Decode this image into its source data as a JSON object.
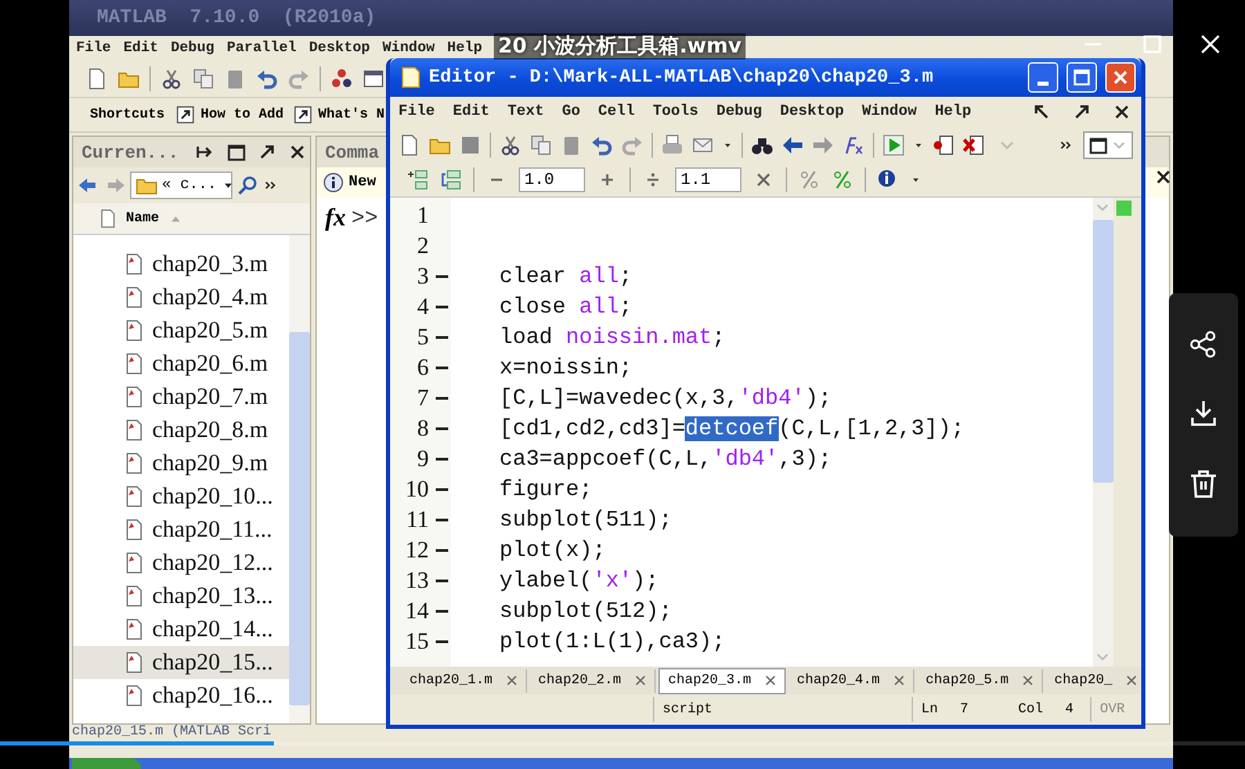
{
  "player": {
    "title": "20 小波分析工具箱.wmv",
    "progress": {
      "level": 0.22
    }
  },
  "matlab": {
    "title": "MATLAB  7.10.0  (R2010a)",
    "menu": [
      "File",
      "Edit",
      "Debug",
      "Parallel",
      "Desktop",
      "Window",
      "Help"
    ],
    "shortcuts": [
      {
        "kind": "label",
        "text": "Shortcuts"
      },
      {
        "kind": "link",
        "text": "How to Add"
      },
      {
        "kind": "link",
        "text": "What's N"
      }
    ],
    "current_folder": {
      "title": "Curren...",
      "path": "« c...",
      "column": "Name",
      "files": [
        {
          "name": "chap20_3.m",
          "selected": false
        },
        {
          "name": "chap20_4.m",
          "selected": false
        },
        {
          "name": "chap20_5.m",
          "selected": false
        },
        {
          "name": "chap20_6.m",
          "selected": false
        },
        {
          "name": "chap20_7.m",
          "selected": false
        },
        {
          "name": "chap20_8.m",
          "selected": false
        },
        {
          "name": "chap20_9.m",
          "selected": false
        },
        {
          "name": "chap20_10...",
          "selected": false
        },
        {
          "name": "chap20_11...",
          "selected": false
        },
        {
          "name": "chap20_12...",
          "selected": false
        },
        {
          "name": "chap20_13...",
          "selected": false
        },
        {
          "name": "chap20_14...",
          "selected": false
        },
        {
          "name": "chap20_15...",
          "selected": true
        },
        {
          "name": "chap20_16...",
          "selected": false
        }
      ]
    },
    "command_window": {
      "title": "Comma",
      "notice": "New",
      "fx": "fx",
      "prompt": ">>"
    },
    "status": "chap20_15.m (MATLAB Scri"
  },
  "editor": {
    "title": "Editor - D:\\Mark-ALL-MATLAB\\chap20\\chap20_3.m",
    "menu": [
      "File",
      "Edit",
      "Text",
      "Go",
      "Cell",
      "Tools",
      "Debug",
      "Desktop",
      "Window",
      "Help"
    ],
    "zoom_value": "1.0",
    "factor_value": "1.1",
    "lines": [
      {
        "number": "1",
        "executable": false
      },
      {
        "number": "2",
        "executable": false
      },
      {
        "number": "3",
        "executable": true,
        "segments": [
          {
            "kind": "plain",
            "text": "clear "
          },
          {
            "kind": "string",
            "text": "all"
          },
          {
            "kind": "plain",
            "text": ";"
          }
        ]
      },
      {
        "number": "4",
        "executable": true,
        "segments": [
          {
            "kind": "plain",
            "text": "close "
          },
          {
            "kind": "string",
            "text": "all"
          },
          {
            "kind": "plain",
            "text": ";"
          }
        ]
      },
      {
        "number": "5",
        "executable": true,
        "segments": [
          {
            "kind": "plain",
            "text": "load "
          },
          {
            "kind": "string",
            "text": "noissin.mat"
          },
          {
            "kind": "plain",
            "text": ";"
          }
        ]
      },
      {
        "number": "6",
        "executable": true,
        "segments": [
          {
            "kind": "plain",
            "text": "x=noissin;"
          }
        ]
      },
      {
        "number": "7",
        "executable": true,
        "segments": [
          {
            "kind": "plain",
            "text": "[C,L]=wavedec(x,3,"
          },
          {
            "kind": "string",
            "text": "'db4'"
          },
          {
            "kind": "plain",
            "text": ");"
          }
        ]
      },
      {
        "number": "8",
        "executable": true,
        "segments": [
          {
            "kind": "plain",
            "text": "[cd1,cd2,cd3]="
          },
          {
            "kind": "selected",
            "text": "detcoef"
          },
          {
            "kind": "plain",
            "text": "(C,L,[1,2,3]);"
          }
        ]
      },
      {
        "number": "9",
        "executable": true,
        "segments": [
          {
            "kind": "plain",
            "text": "ca3=appcoef(C,L,"
          },
          {
            "kind": "string",
            "text": "'db4'"
          },
          {
            "kind": "plain",
            "text": ",3);"
          }
        ]
      },
      {
        "number": "10",
        "executable": true,
        "segments": [
          {
            "kind": "plain",
            "text": "figure;"
          }
        ]
      },
      {
        "number": "11",
        "executable": true,
        "segments": [
          {
            "kind": "plain",
            "text": "subplot(511);"
          }
        ]
      },
      {
        "number": "12",
        "executable": true,
        "segments": [
          {
            "kind": "plain",
            "text": "plot(x);"
          }
        ]
      },
      {
        "number": "13",
        "executable": true,
        "segments": [
          {
            "kind": "plain",
            "text": "ylabel("
          },
          {
            "kind": "string",
            "text": "'x'"
          },
          {
            "kind": "plain",
            "text": ");"
          }
        ]
      },
      {
        "number": "14",
        "executable": true,
        "segments": [
          {
            "kind": "plain",
            "text": "subplot(512);"
          }
        ]
      },
      {
        "number": "15",
        "executable": true,
        "segments": [
          {
            "kind": "plain",
            "text": "plot(1:L(1),ca3);"
          }
        ]
      }
    ],
    "tabs": [
      {
        "label": "chap20_1.m",
        "selected": false
      },
      {
        "label": "chap20_2.m",
        "selected": false
      },
      {
        "label": "chap20_3.m",
        "selected": true
      },
      {
        "label": "chap20_4.m",
        "selected": false
      },
      {
        "label": "chap20_5.m",
        "selected": false
      },
      {
        "label": "chap20_",
        "selected": false
      }
    ],
    "status": {
      "mode": "script",
      "ln_label": "Ln",
      "ln": "7",
      "col_label": "Col",
      "col": "4",
      "ovr": "OVR",
      "ovr_active": false
    }
  }
}
